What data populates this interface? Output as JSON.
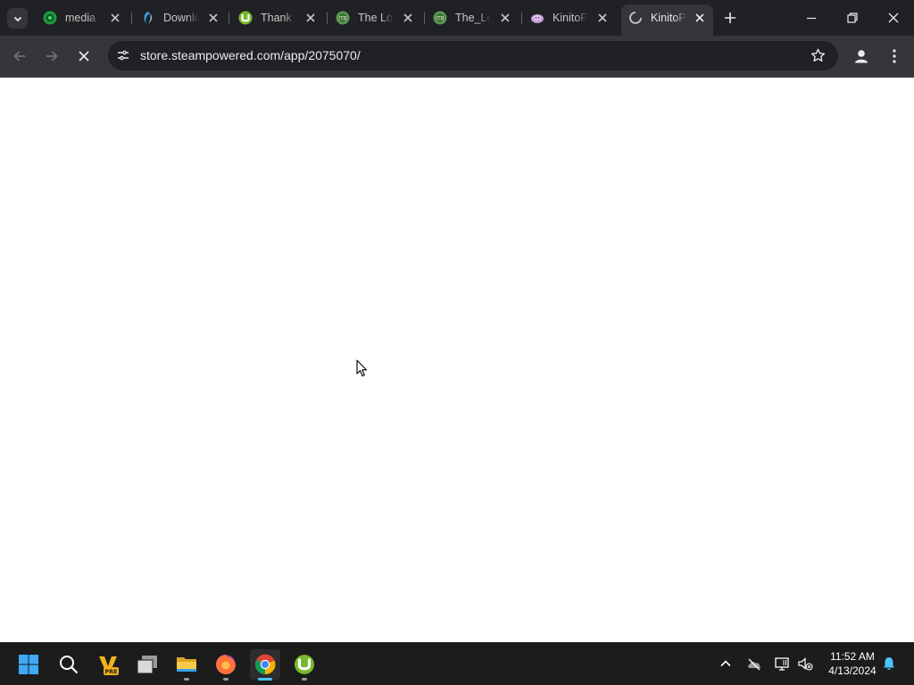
{
  "browser": {
    "tabs": [
      {
        "title": "media",
        "icon": "mediafire-icon",
        "color": "#1e9e3e"
      },
      {
        "title": "Downlo",
        "icon": "download-site-icon",
        "color": "#3aa0e8"
      },
      {
        "title": "Thank y",
        "icon": "utorrent-icon",
        "color": "#77b82c"
      },
      {
        "title": "The Lo",
        "icon": "game-site-icon",
        "color": "#5a9a55"
      },
      {
        "title": "The_Lo",
        "icon": "game-site-icon",
        "color": "#5a9a55"
      },
      {
        "title": "KinitoP",
        "icon": "kinito-icon",
        "color": "#c79ad8"
      },
      {
        "title": "KinitoP",
        "icon": "loading-spinner-icon",
        "active": true
      }
    ],
    "address_url": "store.steampowered.com/app/2075070/",
    "page_state": "loading"
  },
  "taskbar": {
    "apps": [
      {
        "name": "Start",
        "icon": "windows-start-icon"
      },
      {
        "name": "Search",
        "icon": "search-icon"
      },
      {
        "name": "Vegas Pro",
        "icon": "vegas-pro-icon"
      },
      {
        "name": "Task View",
        "icon": "task-view-icon"
      },
      {
        "name": "File Explorer",
        "icon": "folder-icon"
      },
      {
        "name": "Firefox",
        "icon": "firefox-icon"
      },
      {
        "name": "Google Chrome",
        "icon": "chrome-icon",
        "active": true
      },
      {
        "name": "uTorrent",
        "icon": "utorrent-icon"
      }
    ],
    "pre_badge": "PRE",
    "clock_time": "11:52 AM",
    "clock_date": "4/13/2024"
  },
  "colors": {
    "tab_strip": "#202124",
    "toolbar": "#35363a",
    "taskbar": "#1c1c1c",
    "accent": "#4cc2ff"
  }
}
